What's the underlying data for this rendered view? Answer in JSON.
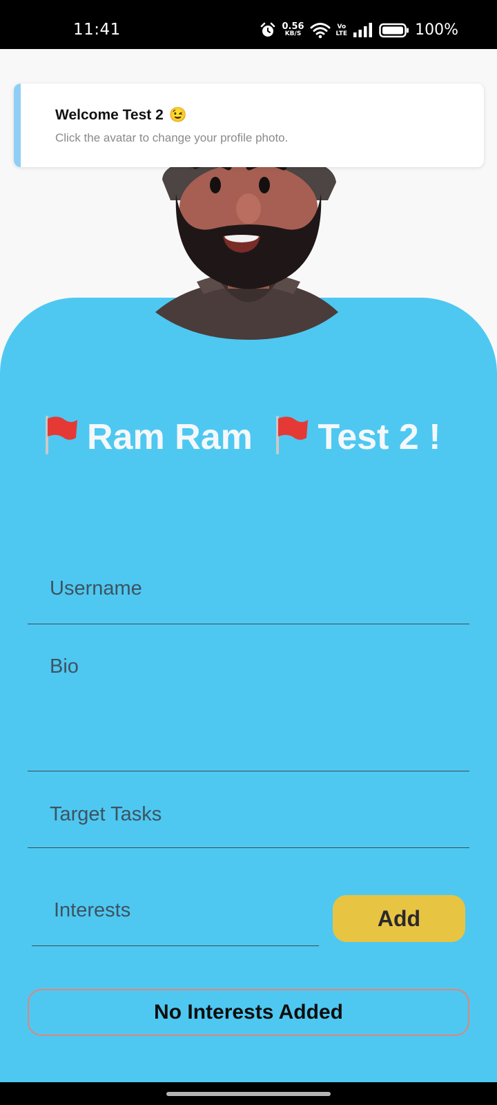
{
  "status_bar": {
    "time": "11:41",
    "net_speed_value": "0.56",
    "net_speed_unit": "KB/S",
    "volte_top": "Vo",
    "volte_bottom": "LTE",
    "battery": "100%",
    "icons": [
      "alarm-icon",
      "wifi-icon",
      "signal-icon",
      "battery-icon"
    ]
  },
  "toast": {
    "title": "Welcome Test 2",
    "emoji": "😉",
    "subtitle": "Click the avatar to change your profile photo.",
    "accent_color": "#8fcff5"
  },
  "greeting": {
    "word1": "Ram Ram",
    "word2": "Test 2 !"
  },
  "form": {
    "username_label": "Username",
    "bio_label": "Bio",
    "target_tasks_label": "Target Tasks",
    "interests_label": "Interests",
    "add_button": "Add",
    "no_interests": "No Interests Added"
  },
  "colors": {
    "card": "#4ec8f1",
    "add_button": "#e8c443",
    "interests_border": "#e0857a"
  }
}
